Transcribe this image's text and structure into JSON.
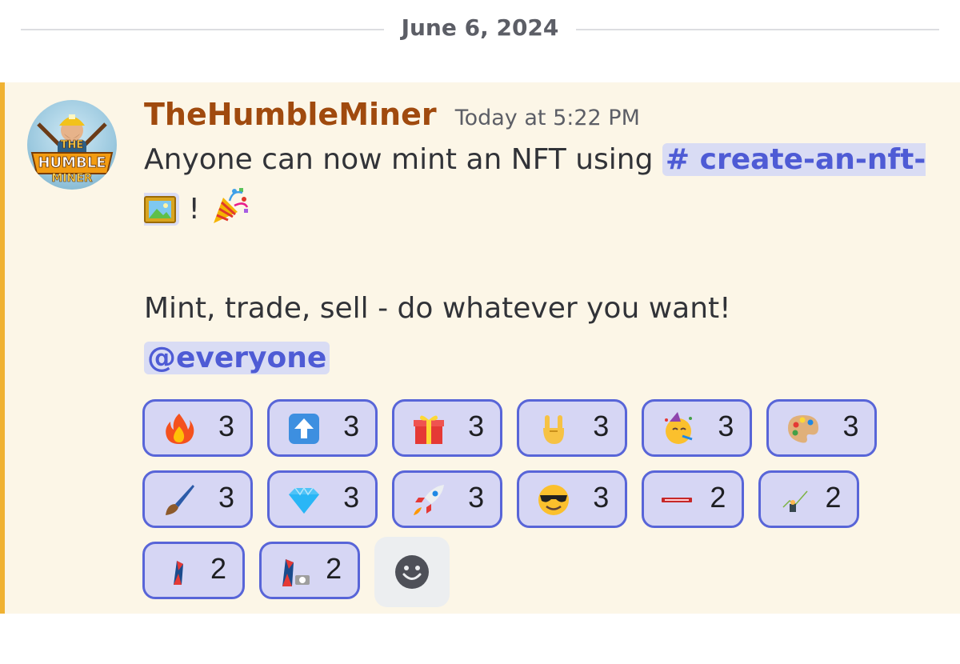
{
  "divider": {
    "date": "June 6, 2024"
  },
  "message": {
    "author": "TheHumbleMiner",
    "timestamp": "Today at 5:22 PM",
    "avatar_text_line1": "THE",
    "avatar_text_line2": "HUMBLE",
    "avatar_text_line3": "MINER",
    "line1_text": "Anyone can now mint an NFT using ",
    "channel_mention": "# create-an-nft-",
    "after_channel": " ! ",
    "line2_text": "Mint, trade, sell - do whatever you want!",
    "everyone_mention": "@everyone"
  },
  "reactions": [
    {
      "emoji": "fire-icon",
      "count": "3"
    },
    {
      "emoji": "up-arrow-icon",
      "count": "3"
    },
    {
      "emoji": "gift-icon",
      "count": "3"
    },
    {
      "emoji": "rock-hand-icon",
      "count": "3"
    },
    {
      "emoji": "partying-face-icon",
      "count": "3"
    },
    {
      "emoji": "palette-icon",
      "count": "3"
    },
    {
      "emoji": "paintbrush-icon",
      "count": "3"
    },
    {
      "emoji": "gem-icon",
      "count": "3"
    },
    {
      "emoji": "rocket-icon",
      "count": "3"
    },
    {
      "emoji": "sunglasses-face-icon",
      "count": "3"
    },
    {
      "emoji": "custom-banner-emoji",
      "count": "2"
    },
    {
      "emoji": "custom-miner-emoji",
      "count": "2"
    },
    {
      "emoji": "custom-bird-emoji",
      "count": "2"
    },
    {
      "emoji": "custom-bird-camera-emoji",
      "count": "2"
    }
  ],
  "colors": {
    "author": "#a04a0e",
    "highlight_bar": "#f0b232",
    "highlight_bg": "#fcf6e7",
    "mention_text": "#4e5bd5",
    "mention_bg": "#d9dcf4",
    "reaction_border": "#5865d8",
    "reaction_bg": "#d6d6f4"
  }
}
